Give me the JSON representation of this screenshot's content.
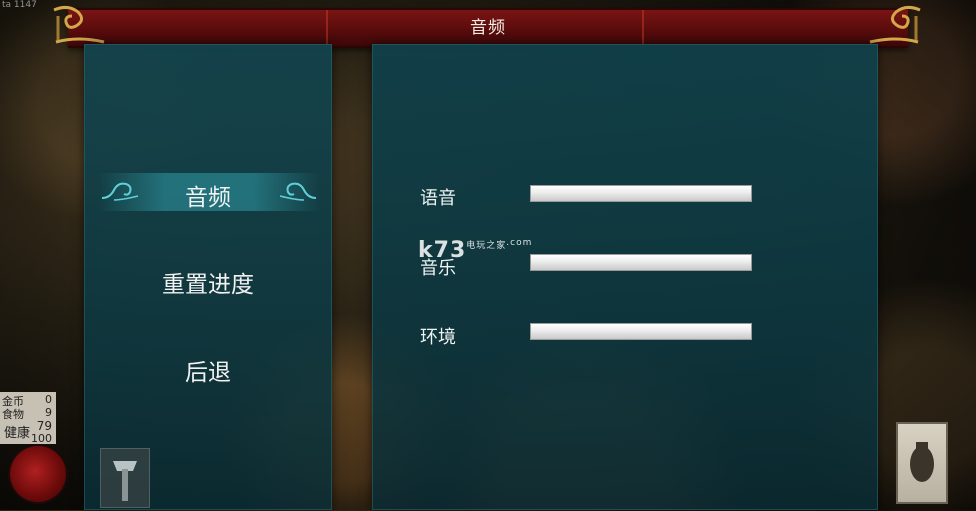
{
  "window": {
    "title": "音频",
    "version_tag": "ta 1147"
  },
  "menu": {
    "items": [
      {
        "label": "音频",
        "selected": true
      },
      {
        "label": "重置进度",
        "selected": false
      },
      {
        "label": "后退",
        "selected": false
      }
    ]
  },
  "audio_settings": {
    "rows": [
      {
        "label": "语音",
        "level": 1.0
      },
      {
        "label": "音乐",
        "level": 1.0
      },
      {
        "label": "环境",
        "level": 1.0
      }
    ]
  },
  "hud": {
    "stats": [
      {
        "label": "金币",
        "value": "0"
      },
      {
        "label": "食物",
        "value": "9"
      },
      {
        "label": "健康",
        "value": "79",
        "max": "100"
      }
    ]
  },
  "watermark": {
    "brand": "k73",
    "tag": "电玩之家",
    "domain": ".com"
  },
  "colors": {
    "title_bar": "#6a1010",
    "panel": "#124650",
    "highlight": "#2a8a94",
    "slider": "#e8e8e8"
  }
}
